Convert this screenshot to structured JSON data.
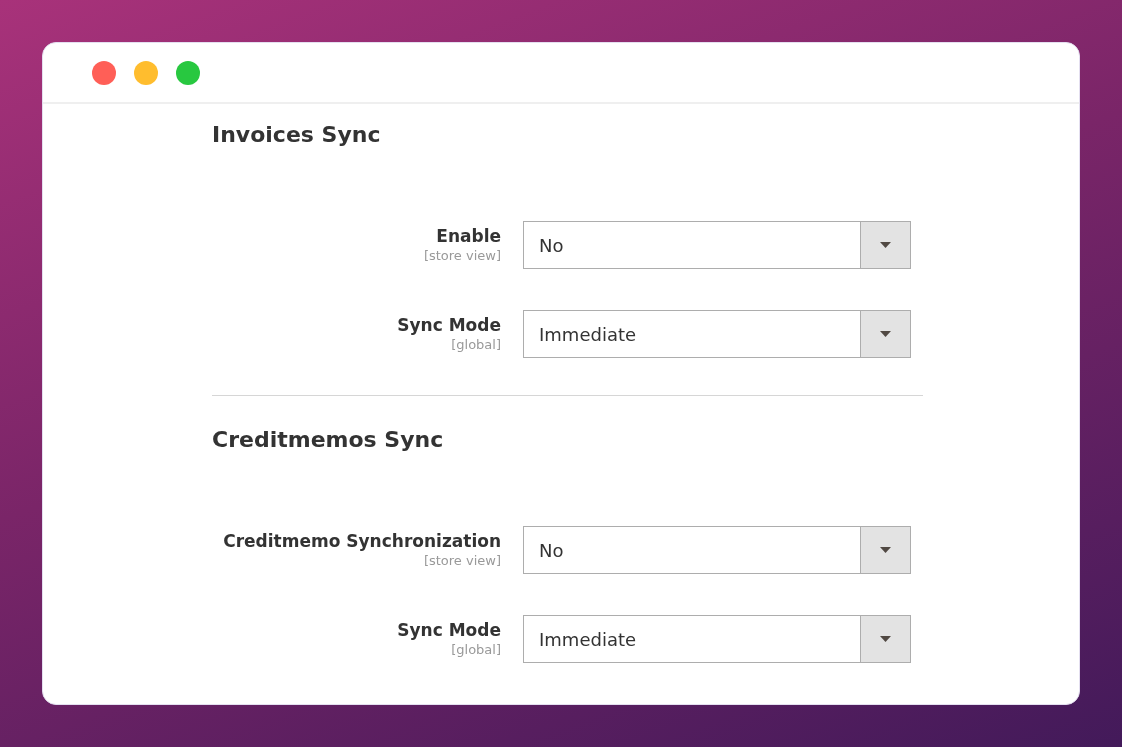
{
  "window": {
    "controls": [
      {
        "color": "#ff5f57"
      },
      {
        "color": "#ffbd2e"
      },
      {
        "color": "#28c840"
      }
    ]
  },
  "sections": [
    {
      "title": "Invoices Sync",
      "fields": [
        {
          "label": "Enable",
          "scope": "[store view]",
          "value": "No"
        },
        {
          "label": "Sync Mode",
          "scope": "[global]",
          "value": "Immediate"
        }
      ]
    },
    {
      "title": "Creditmemos Sync",
      "fields": [
        {
          "label": "Creditmemo Synchronization",
          "scope": "[store view]",
          "value": "No"
        },
        {
          "label": "Sync Mode",
          "scope": "[global]",
          "value": "Immediate"
        }
      ]
    }
  ]
}
